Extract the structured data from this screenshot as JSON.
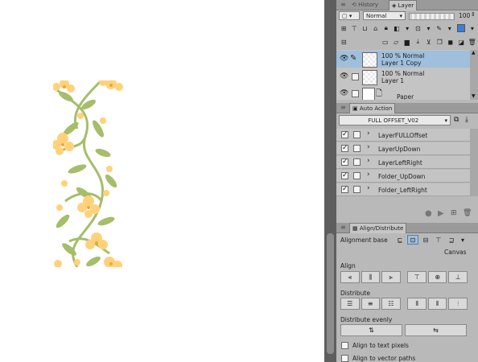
{
  "layer_panel": {
    "tabs": [
      {
        "label": "History"
      },
      {
        "label": "Layer"
      }
    ],
    "blend_mode": "Normal",
    "opacity_value": "100",
    "layers": [
      {
        "line1": "100 % Normal",
        "line2": "Layer 1 Copy",
        "selected": true
      },
      {
        "line1": "100 % Normal",
        "line2": "Layer 1",
        "selected": false
      },
      {
        "line1": "",
        "line2": "Paper",
        "selected": false
      }
    ]
  },
  "auto_action": {
    "tab_label": "Auto Action",
    "set_name": "FULL OFFSET_V02",
    "actions": [
      {
        "label": "LayerFULLOffset"
      },
      {
        "label": "LayerUpDown"
      },
      {
        "label": "LayerLeftRight"
      },
      {
        "label": "Folder_UpDown"
      },
      {
        "label": "Folder_LeftRight"
      }
    ]
  },
  "align_panel": {
    "tab_label": "Align/Distribute",
    "alignment_base_label": "Alignment base",
    "alignment_base_value": "Canvas",
    "align_label": "Align",
    "distribute_label": "Distribute",
    "distribute_evenly_label": "Distribute evenly",
    "align_text_label": "Align to text pixels",
    "align_vector_label": "Align to vector paths"
  },
  "colors": {
    "petal": "#ffd27a",
    "leaf": "#a6bd6a",
    "selection": "#9fbfdc",
    "panel_bg": "#b9b9b9"
  }
}
